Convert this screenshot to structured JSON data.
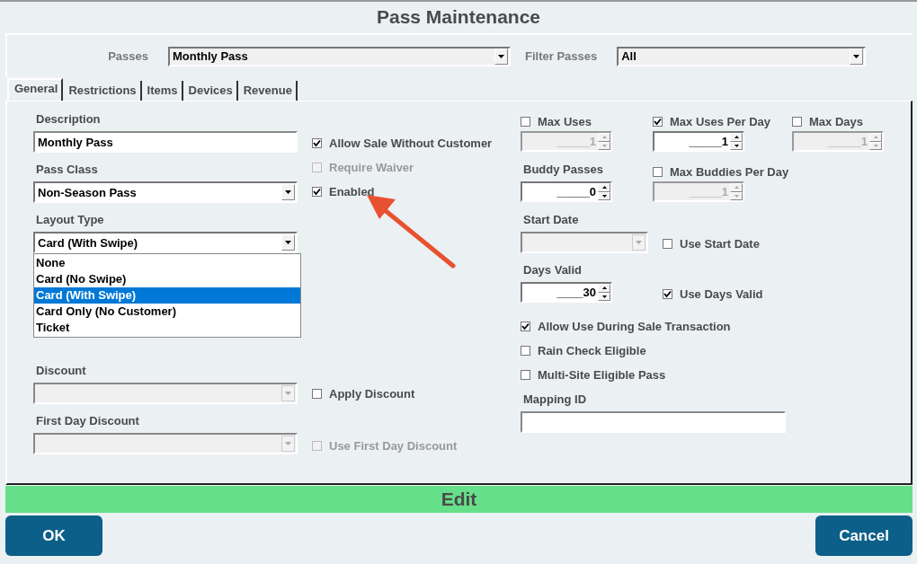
{
  "window": {
    "title": "Pass Maintenance"
  },
  "header": {
    "passes": {
      "label": "Passes",
      "value": "Monthly Pass"
    },
    "filter": {
      "label": "Filter Passes",
      "value": "All"
    }
  },
  "tabs": [
    {
      "label": "General",
      "selected": true
    },
    {
      "label": "Restrictions",
      "selected": false
    },
    {
      "label": "Items",
      "selected": false
    },
    {
      "label": "Devices",
      "selected": false
    },
    {
      "label": "Revenue",
      "selected": false
    }
  ],
  "general": {
    "description": {
      "label": "Description",
      "value": "Monthly Pass"
    },
    "pass_class": {
      "label": "Pass Class",
      "value": "Non-Season Pass",
      "disabled": false
    },
    "layout_type": {
      "label": "Layout Type",
      "value": "Card (With Swipe)",
      "disabled": false,
      "expanded": true,
      "options": [
        {
          "label": "None",
          "selected": false
        },
        {
          "label": "Card (No Swipe)",
          "selected": false
        },
        {
          "label": "Card (With Swipe)",
          "selected": true
        },
        {
          "label": "Card Only (No Customer)",
          "selected": false
        },
        {
          "label": "Ticket",
          "selected": false
        }
      ]
    },
    "discount": {
      "label": "Discount",
      "disabled": true
    },
    "first_day_discount": {
      "label": "First Day Discount",
      "disabled": true
    },
    "sale_options": [
      {
        "label": "Allow Sale Without Customer",
        "checked": true,
        "disabled": false
      },
      {
        "label": "Require Waiver",
        "checked": false,
        "disabled": true
      },
      {
        "label": "Enabled",
        "checked": true,
        "disabled": false
      }
    ],
    "apply_discount": {
      "label": "Apply Discount",
      "checked": false,
      "disabled": false
    },
    "use_first_day_discount": {
      "label": "Use First Day Discount",
      "checked": false,
      "disabled": true
    },
    "limits": [
      {
        "label": "Max Uses",
        "checked": false,
        "spinner": {
          "value": "_____1",
          "disabled": true
        }
      },
      {
        "label": "Max Uses Per Day",
        "checked": true,
        "spinner": {
          "value": "_____1",
          "disabled": false
        }
      },
      {
        "label": "Max Days",
        "checked": false,
        "spinner": {
          "value": "_____1",
          "disabled": true
        }
      }
    ],
    "buddy_passes": {
      "label": "Buddy Passes",
      "spinner": {
        "value": "_____0",
        "disabled": false
      }
    },
    "max_buddies": {
      "label": "Max Buddies Per Day",
      "checked": false,
      "spinner": {
        "value": "_____1",
        "disabled": true
      }
    },
    "start_date": {
      "label": "Start Date",
      "disabled": true
    },
    "use_start_date": {
      "label": "Use Start Date",
      "checked": false
    },
    "days_valid": {
      "label": "Days Valid",
      "spinner": {
        "value": "____30",
        "disabled": false
      }
    },
    "use_days_valid": {
      "label": "Use Days Valid",
      "checked": true
    },
    "flags": [
      {
        "label": "Allow Use During Sale Transaction",
        "checked": true
      },
      {
        "label": "Rain Check Eligible",
        "checked": false
      },
      {
        "label": "Multi-Site Eligible Pass",
        "checked": false
      }
    ],
    "mapping_id": {
      "label": "Mapping ID"
    }
  },
  "mode": {
    "label": "Edit"
  },
  "buttons": [
    {
      "label": "OK"
    },
    {
      "label": "Cancel"
    }
  ]
}
